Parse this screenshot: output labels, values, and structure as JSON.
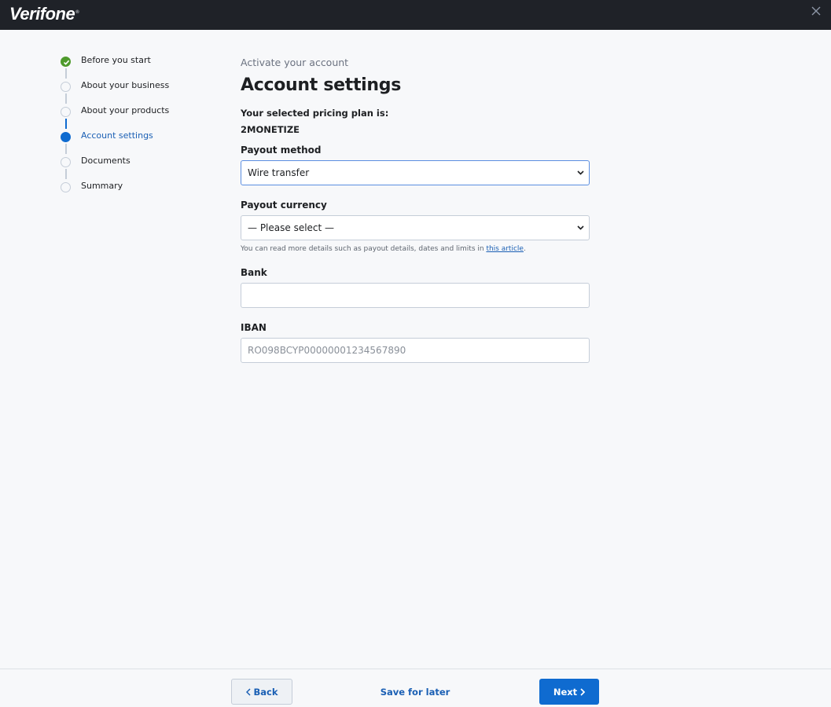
{
  "header": {
    "logo": "Verifone",
    "logo_mark": "®",
    "close_icon": "close-icon"
  },
  "stepper": {
    "steps": [
      {
        "label": "Before you start",
        "state": "done"
      },
      {
        "label": "About your business",
        "state": "pending"
      },
      {
        "label": "About your products",
        "state": "pending"
      },
      {
        "label": "Account settings",
        "state": "active"
      },
      {
        "label": "Documents",
        "state": "pending"
      },
      {
        "label": "Summary",
        "state": "pending"
      }
    ]
  },
  "main": {
    "subtitle": "Activate your account",
    "title": "Account settings",
    "plan_label": "Your selected pricing plan is:",
    "plan_value": "2MONETIZE",
    "payout_method": {
      "label": "Payout method",
      "value": "Wire transfer"
    },
    "payout_currency": {
      "label": "Payout currency",
      "value": "— Please select —"
    },
    "helper": {
      "text": "You can read more details such as payout details, dates and limits in ",
      "link": "this article",
      "suffix": "."
    },
    "bank": {
      "label": "Bank",
      "value": ""
    },
    "iban": {
      "label": "IBAN",
      "placeholder": "RO098BCYP00000001234567890"
    }
  },
  "footer": {
    "back_label": "Back",
    "save_label": "Save for later",
    "next_label": "Next"
  },
  "colors": {
    "brand_blue": "#0f6bd0",
    "success_green": "#4e9a2c",
    "topbar": "#1f2228"
  }
}
